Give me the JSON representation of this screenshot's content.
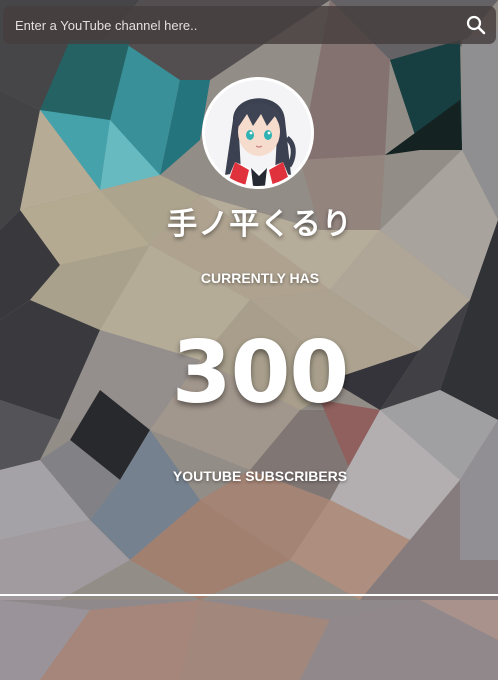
{
  "search": {
    "placeholder": "Enter a YouTube channel here..",
    "button_icon": "search-icon"
  },
  "channel": {
    "name": "手ノ平くるり",
    "avatar_icon": "anime-avatar"
  },
  "stats": {
    "caption_top": "CURRENTLY HAS",
    "subscriber_count": "300",
    "caption_bottom": "YOUTUBE SUBSCRIBERS"
  },
  "theme": {
    "accent": "#ffffff",
    "search_bar_bg": "#463e3e"
  }
}
